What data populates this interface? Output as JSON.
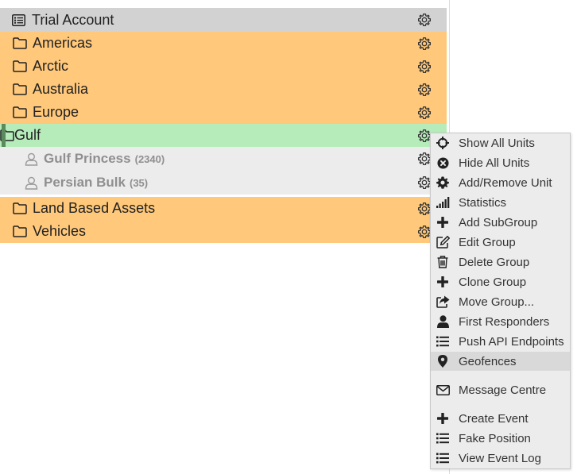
{
  "tree": {
    "account": {
      "label": "Trial Account",
      "icon": "list-icon"
    },
    "groups_top": [
      {
        "label": "Americas",
        "icon": "folder-icon"
      },
      {
        "label": "Arctic",
        "icon": "folder-icon"
      },
      {
        "label": "Australia",
        "icon": "folder-icon"
      },
      {
        "label": "Europe",
        "icon": "folder-icon"
      },
      {
        "label": "Gulf",
        "icon": "folder-icon",
        "active": true
      }
    ],
    "units": [
      {
        "label": "Gulf Princess",
        "count": "(2340)",
        "icon": "user-icon"
      },
      {
        "label": "Persian Bulk",
        "count": "(35)",
        "icon": "user-icon"
      }
    ],
    "groups_bottom": [
      {
        "label": "Land Based Assets",
        "icon": "folder-icon"
      },
      {
        "label": "Vehicles",
        "icon": "folder-icon"
      }
    ]
  },
  "context_menu": {
    "items": [
      {
        "label": "Show All Units",
        "icon": "crosshairs-icon"
      },
      {
        "label": "Hide All Units",
        "icon": "times-circle-icon"
      },
      {
        "label": "Add/Remove Unit",
        "icon": "cog-icon"
      },
      {
        "label": "Statistics",
        "icon": "signal-icon"
      },
      {
        "label": "Add SubGroup",
        "icon": "plus-icon"
      },
      {
        "label": "Edit Group",
        "icon": "edit-icon"
      },
      {
        "label": "Delete Group",
        "icon": "trash-icon"
      },
      {
        "label": "Clone Group",
        "icon": "plus-icon"
      },
      {
        "label": "Move Group...",
        "icon": "share-icon"
      },
      {
        "label": "First Responders",
        "icon": "user-solid-icon"
      },
      {
        "label": "Push API Endpoints",
        "icon": "list-ul-icon"
      },
      {
        "label": "Geofences",
        "icon": "map-marker-icon",
        "hovered": true
      },
      {
        "label": "Message Centre",
        "icon": "envelope-icon"
      },
      {
        "label": "Create Event",
        "icon": "plus-icon"
      },
      {
        "label": "Fake Position",
        "icon": "list-ul-icon"
      },
      {
        "label": "View Event Log",
        "icon": "list-ul-icon"
      }
    ]
  },
  "colors": {
    "header_bg": "#d2d2d2",
    "group_bg": "#ffc87a",
    "active_bg": "#b6ecba",
    "unit_bg": "#ececec",
    "menu_bg": "#ececec"
  }
}
